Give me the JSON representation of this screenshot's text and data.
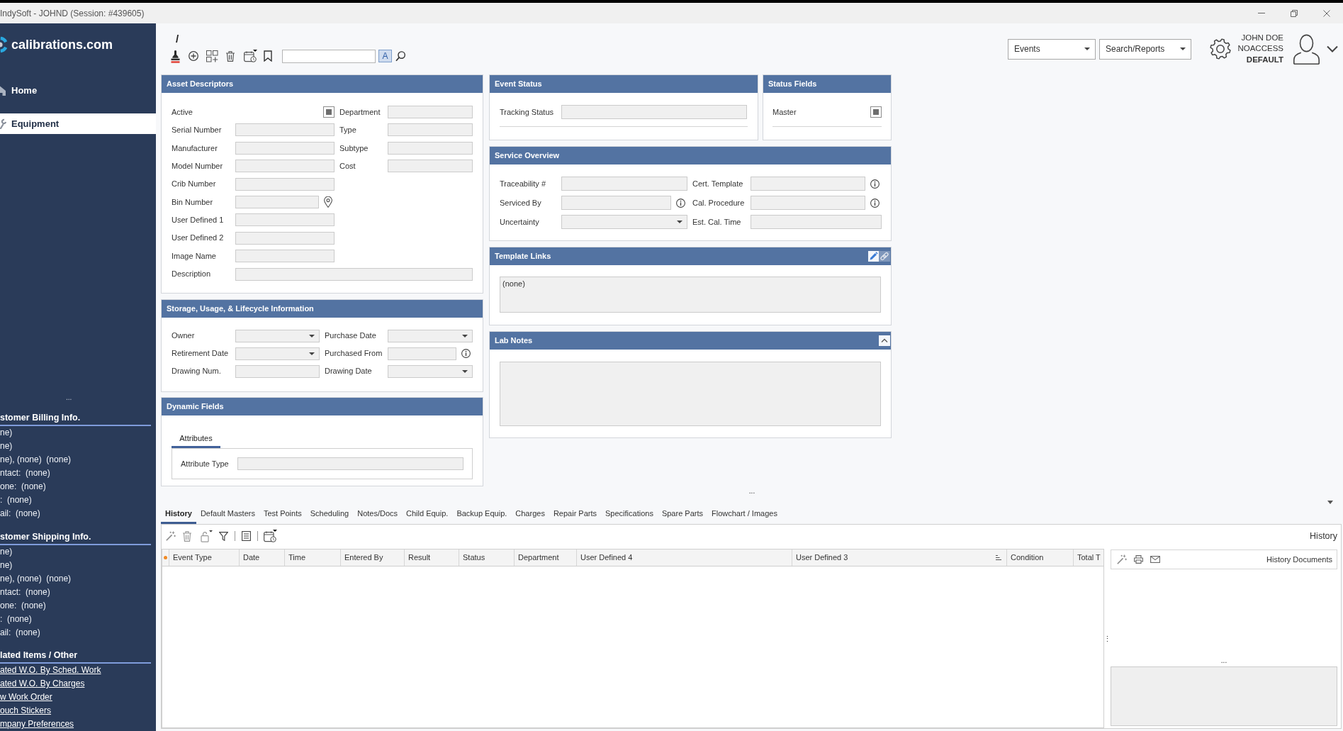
{
  "window": {
    "title": "IndySoft - JOHND (Session: #439605)"
  },
  "sidebar": {
    "logo": "calibrations.com",
    "nav": [
      {
        "label": "Home",
        "selected": false
      },
      {
        "label": "Equipment",
        "selected": true
      }
    ],
    "overflow": "...",
    "sections": [
      {
        "title": "stomer Billing Info.",
        "kind": "info",
        "items": [
          "ne)",
          "ne)",
          "ne), (none)  (none)",
          "ntact:  (none)",
          "one:  (none)",
          ":  (none)",
          "ail:  (none)"
        ]
      },
      {
        "title": "stomer Shipping Info.",
        "kind": "info",
        "items": [
          "ne)",
          "ne)",
          "ne), (none)  (none)",
          "ntact:  (none)",
          "one:  (none)",
          ":  (none)",
          "ail:  (none)"
        ]
      },
      {
        "title": "lated Items / Other",
        "kind": "links",
        "items": [
          "ated W.O. By Sched. Work",
          "ated W.O. By Charges",
          "w Work Order",
          "ouch Stickers",
          "mpany Preferences"
        ]
      }
    ]
  },
  "toolbar": {
    "path": "/",
    "case_toggle": {
      "label": "A",
      "on": true
    }
  },
  "header_right": {
    "menus": [
      "Events",
      "Search/Reports"
    ],
    "user": {
      "name": "JOHN DOE",
      "access": "NOACCESS",
      "profile": "DEFAULT"
    }
  },
  "panels": {
    "asset_descriptors": {
      "title": "Asset Descriptors",
      "rows": [
        [
          {
            "label": "Active",
            "kind": "checkbox",
            "indeterminate": true
          },
          {
            "label": "Department",
            "kind": "text"
          }
        ],
        [
          {
            "label": "Serial Number",
            "kind": "text"
          },
          {
            "label": "Type",
            "kind": "text"
          }
        ],
        [
          {
            "label": "Manufacturer",
            "kind": "text"
          },
          {
            "label": "Subtype",
            "kind": "text"
          }
        ],
        [
          {
            "label": "Model Number",
            "kind": "text"
          },
          {
            "label": "Cost",
            "kind": "text"
          }
        ],
        [
          {
            "label": "Crib Number",
            "kind": "text"
          }
        ],
        [
          {
            "label": "Bin Number",
            "kind": "location"
          }
        ],
        [
          {
            "label": "User Defined 1",
            "kind": "text"
          }
        ],
        [
          {
            "label": "User Defined 2",
            "kind": "text"
          }
        ],
        [
          {
            "label": "Image Name",
            "kind": "text"
          }
        ],
        [
          {
            "label": "Description",
            "kind": "wide"
          }
        ]
      ]
    },
    "event_status": {
      "title": "Event Status",
      "rows": [
        [
          {
            "label": "Tracking Status",
            "kind": "text"
          }
        ]
      ]
    },
    "status_fields": {
      "title": "Status Fields",
      "rows": [
        [
          {
            "label": "Master",
            "kind": "checkbox",
            "indeterminate": true
          }
        ]
      ]
    },
    "service_overview": {
      "title": "Service Overview",
      "rows": [
        [
          {
            "label": "Traceability #",
            "kind": "text"
          },
          {
            "label": "Cert. Template",
            "kind": "info"
          }
        ],
        [
          {
            "label": "Serviced By",
            "kind": "info"
          },
          {
            "label": "Cal. Procedure",
            "kind": "info"
          }
        ],
        [
          {
            "label": "Uncertainty",
            "kind": "dropdown"
          },
          {
            "label": "Est. Cal. Time",
            "kind": "text"
          }
        ]
      ]
    },
    "storage": {
      "title": "Storage, Usage, & Lifecycle Information",
      "rows": [
        [
          {
            "label": "Owner",
            "kind": "dropdown"
          },
          {
            "label": "Purchase Date",
            "kind": "dropdown"
          }
        ],
        [
          {
            "label": "Retirement Date",
            "kind": "dropdown"
          },
          {
            "label": "Purchased From",
            "kind": "info"
          }
        ],
        [
          {
            "label": "Drawing Num.",
            "kind": "text"
          },
          {
            "label": "Drawing Date",
            "kind": "dropdown"
          }
        ]
      ]
    },
    "template_links": {
      "title": "Template Links",
      "value": "(none)"
    },
    "dynamic_fields": {
      "title": "Dynamic Fields",
      "tabs": [
        {
          "label": "Attributes",
          "selected": true
        }
      ],
      "rows": [
        [
          {
            "label": "Attribute Type",
            "kind": "text"
          }
        ]
      ]
    },
    "lab_notes": {
      "title": "Lab Notes",
      "expanded": true
    }
  },
  "bottom": {
    "splitter": "...",
    "tabs": [
      {
        "label": "History",
        "selected": true
      },
      {
        "label": "Default Masters",
        "selected": false
      },
      {
        "label": "Test Points",
        "selected": false
      },
      {
        "label": "Scheduling",
        "selected": false
      },
      {
        "label": "Notes/Docs",
        "selected": false
      },
      {
        "label": "Child Equip.",
        "selected": false
      },
      {
        "label": "Backup Equip.",
        "selected": false
      },
      {
        "label": "Charges",
        "selected": false
      },
      {
        "label": "Repair Parts",
        "selected": false
      },
      {
        "label": "Specifications",
        "selected": false
      },
      {
        "label": "Spare Parts",
        "selected": false
      },
      {
        "label": "Flowchart / Images",
        "selected": false
      }
    ],
    "pane_title": "History",
    "grid": {
      "columns": [
        {
          "label": "Event Type",
          "sorted": false
        },
        {
          "label": "Date",
          "sorted": false
        },
        {
          "label": "Time",
          "sorted": false
        },
        {
          "label": "Entered By",
          "sorted": false
        },
        {
          "label": "Result",
          "sorted": false
        },
        {
          "label": "Status",
          "sorted": false
        },
        {
          "label": "Department",
          "sorted": false
        },
        {
          "label": "User Defined 4",
          "sorted": false
        },
        {
          "label": "User Defined 3",
          "sorted": true
        },
        {
          "label": "Condition",
          "sorted": false
        },
        {
          "label": "Total T",
          "sorted": false
        }
      ]
    },
    "divider": "⋮",
    "documents": {
      "title": "History Documents",
      "splitter": "..."
    }
  }
}
